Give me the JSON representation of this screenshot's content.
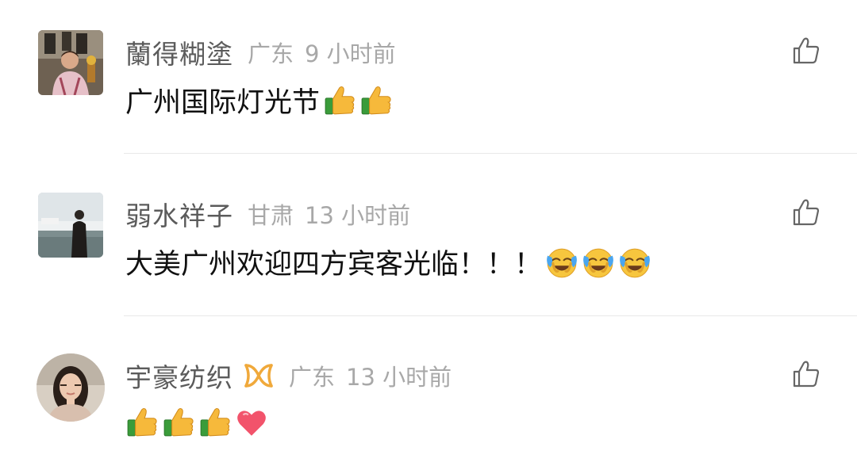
{
  "comments": [
    {
      "name": "蘭得糊塗",
      "location": "广东",
      "time": "9 小时前",
      "text": "广州国际灯光节",
      "emojis": [
        "thumbs-up-emoji",
        "thumbs-up-emoji"
      ]
    },
    {
      "name": "弱水祥子",
      "location": "甘肃",
      "time": "13 小时前",
      "text": "大美广州欢迎四方宾客光临！！！",
      "emojis": [
        "crying-laughing-emoji",
        "crying-laughing-emoji",
        "crying-laughing-emoji"
      ]
    },
    {
      "name": "宇豪纺织",
      "location": "广东",
      "time": "13 小时前",
      "text": "",
      "emojis": [
        "thumbs-up-emoji",
        "thumbs-up-emoji",
        "thumbs-up-emoji",
        "heart-emoji"
      ],
      "badge": "vip-badge-icon"
    }
  ],
  "icons": {
    "like": "thumb-up-outline-icon"
  },
  "colors": {
    "name": "#5b5b5b",
    "meta": "#a8a8a8",
    "text": "#111111",
    "badge": "#f0a93b",
    "heart": "#f2536b"
  }
}
